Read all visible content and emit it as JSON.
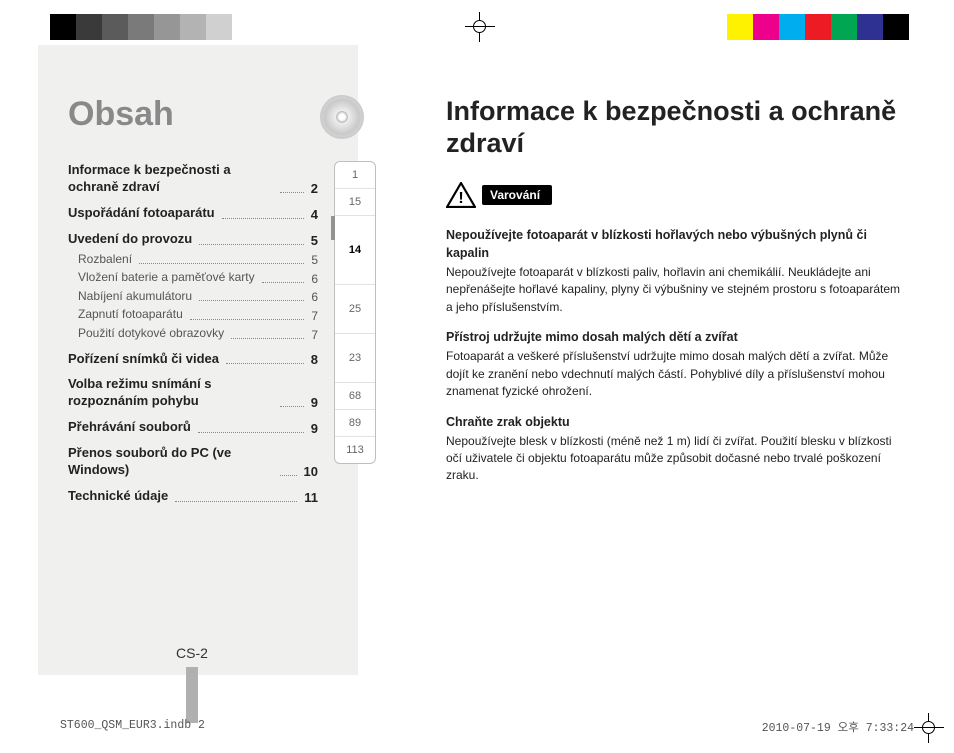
{
  "colorbar": {
    "left": [
      "#000000",
      "#3a3a3a",
      "#5b5b5b",
      "#7a7a7a",
      "#969696",
      "#b3b3b3",
      "#d0d0d0",
      "#ffffff"
    ],
    "right": [
      "#ffffff",
      "#fff200",
      "#ec008c",
      "#00aeef",
      "#ed1c24",
      "#00a651",
      "#2e3192",
      "#000000"
    ]
  },
  "left": {
    "title": "Obsah",
    "toc": [
      {
        "label": "Informace k bezpečnosti a ochraně zdraví",
        "page": "2",
        "bold": true
      },
      {
        "label": "Uspořádání fotoaparátu",
        "page": "4",
        "bold": true
      },
      {
        "label": "Uvedení do provozu",
        "page": "5",
        "bold": true
      },
      {
        "label": "Rozbalení",
        "page": "5",
        "bold": false
      },
      {
        "label": "Vložení baterie a paměťové karty",
        "page": "6",
        "bold": false
      },
      {
        "label": "Nabíjení akumulátoru",
        "page": "6",
        "bold": false
      },
      {
        "label": "Zapnutí fotoaparátu",
        "page": "7",
        "bold": false
      },
      {
        "label": "Použití dotykové obrazovky",
        "page": "7",
        "bold": false
      },
      {
        "label": "Pořízení snímků či videa",
        "page": "8",
        "bold": true
      },
      {
        "label": "Volba režimu snímání s rozpoznáním pohybu",
        "page": "9",
        "bold": true
      },
      {
        "label": "Přehrávání souborů",
        "page": "9",
        "bold": true
      },
      {
        "label": "Přenos souborů do PC (ve Windows)",
        "page": "10",
        "bold": true
      },
      {
        "label": "Technické údaje",
        "page": "11",
        "bold": true
      }
    ],
    "tower": [
      "1",
      "15",
      "14",
      "25",
      "23",
      "68",
      "89",
      "113"
    ],
    "tower_active_index": 2,
    "page_label": "CS-2"
  },
  "right": {
    "title": "Informace k bezpečnosti a ochraně zdraví",
    "warn_label": "Varování",
    "sections": [
      {
        "head": "Nepoužívejte fotoaparát v blízkosti hořlavých nebo výbušných plynů či kapalin",
        "body": "Nepoužívejte fotoaparát v blízkosti paliv, hořlavin ani chemikálií. Neukládejte ani nepřenášejte hořlavé kapaliny, plyny či výbušniny ve stejném prostoru s fotoaparátem a jeho příslušenstvím."
      },
      {
        "head": "Přístroj udržujte mimo dosah malých dětí a zvířat",
        "body": "Fotoaparát a veškeré příslušenství udržujte mimo dosah malých dětí a zvířat. Může dojít ke zranění nebo vdechnutí malých částí. Pohyblivé díly a příslušenství mohou znamenat fyzické ohrožení."
      },
      {
        "head": "Chraňte zrak objektu",
        "body": "Nepoužívejte blesk v blízkosti (méně než 1 m) lidí či zvířat. Použití blesku v blízkosti očí uživatele či objektu fotoaparátu může způsobit dočasné nebo trvalé poškození zraku."
      }
    ]
  },
  "footer": {
    "left": "ST600_QSM_EUR3.indb   2",
    "right": "2010-07-19   오후 7:33:24"
  }
}
